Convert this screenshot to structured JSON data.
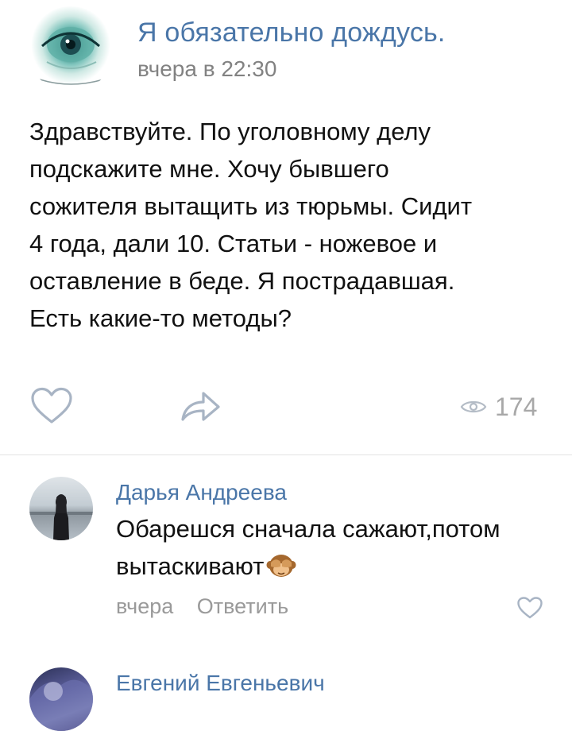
{
  "post": {
    "author": "Я обязательно дождусь.",
    "time": "вчера в 22:30",
    "text_lines": [
      "Здравствуйте. По уголовному делу",
      "подскажите мне. Хочу бывшего",
      "сожителя вытащить из тюрьмы. Сидит",
      "4 года, дали 10. Статьи - ножевое и",
      "оставление в беде. Я пострадавшая.",
      "Есть какие-то методы?"
    ],
    "views": "174",
    "icons": {
      "like": "heart-outline-icon",
      "share": "share-arrow-icon",
      "views": "eye-icon"
    }
  },
  "comments": [
    {
      "author": "Дарья Андреева",
      "text_lines": [
        "Обарешся сначала сажают,потом",
        "вытаскивают"
      ],
      "emoji": "see-no-evil-monkey",
      "time": "вчера",
      "reply_label": "Ответить"
    },
    {
      "author": "Евгений Евгеньевич"
    }
  ],
  "colors": {
    "link": "#4a76a8",
    "secondary": "#828282",
    "icon": "#a8b4c4"
  }
}
